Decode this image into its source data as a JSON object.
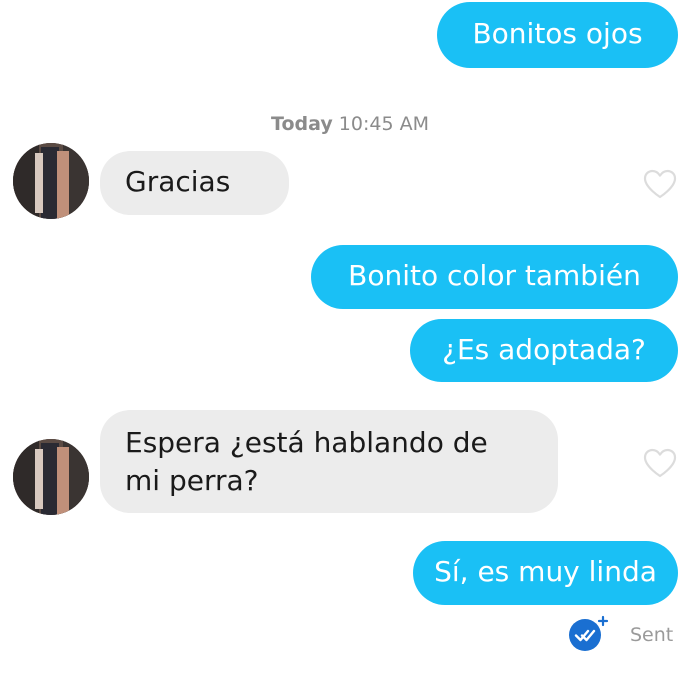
{
  "messages": {
    "m1": "Bonitos ojos",
    "m2": "Gracias",
    "m3": "Bonito color también",
    "m4": "¿Es adoptada?",
    "m5_line1": "Espera ¿está hablando de",
    "m5_line2": "mi perra?",
    "m6": "Sí, es muy linda"
  },
  "timestamp": {
    "day": "Today",
    "time": "10:45 AM"
  },
  "status": {
    "sent_label": "Sent",
    "read_icon": "double-check-icon"
  },
  "icons": {
    "like": "heart-outline-icon",
    "avatar": "contact-avatar"
  },
  "colors": {
    "outgoing_bubble": "#1ac0f5",
    "incoming_bubble": "#ececec",
    "read_badge": "#1a6fd1"
  }
}
